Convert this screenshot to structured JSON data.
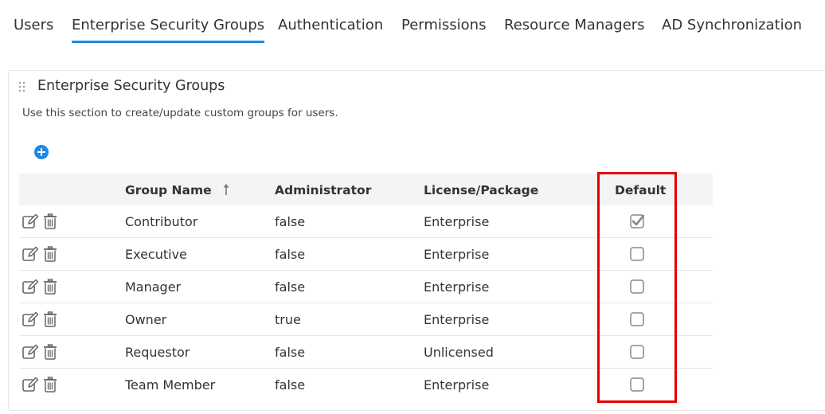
{
  "tabs": [
    {
      "label": "Users",
      "active": false
    },
    {
      "label": "Enterprise Security Groups",
      "active": true
    },
    {
      "label": "Authentication",
      "active": false
    },
    {
      "label": "Permissions",
      "active": false
    },
    {
      "label": "Resource Managers",
      "active": false
    },
    {
      "label": "AD Synchronization",
      "active": false
    }
  ],
  "panel": {
    "title": "Enterprise Security Groups",
    "description": "Use this section to create/update custom groups for users."
  },
  "table": {
    "headers": {
      "group_name": "Group Name",
      "administrator": "Administrator",
      "license": "License/Package",
      "default": "Default"
    },
    "rows": [
      {
        "group_name": "Contributor",
        "administrator": "false",
        "license": "Enterprise",
        "default": true
      },
      {
        "group_name": "Executive",
        "administrator": "false",
        "license": "Enterprise",
        "default": false
      },
      {
        "group_name": "Manager",
        "administrator": "false",
        "license": "Enterprise",
        "default": false
      },
      {
        "group_name": "Owner",
        "administrator": "true",
        "license": "Enterprise",
        "default": false
      },
      {
        "group_name": "Requestor",
        "administrator": "false",
        "license": "Unlicensed",
        "default": false
      },
      {
        "group_name": "Team Member",
        "administrator": "false",
        "license": "Enterprise",
        "default": false
      }
    ]
  },
  "icons": {
    "add": "plus-circle-icon",
    "edit": "edit-icon",
    "delete": "trash-icon",
    "sort": "sort-ascending-icon",
    "drag": "drag-handle-icon"
  },
  "colors": {
    "accent": "#1e88e5",
    "highlight": "#e30000",
    "header_bg": "#f4f4f4"
  }
}
